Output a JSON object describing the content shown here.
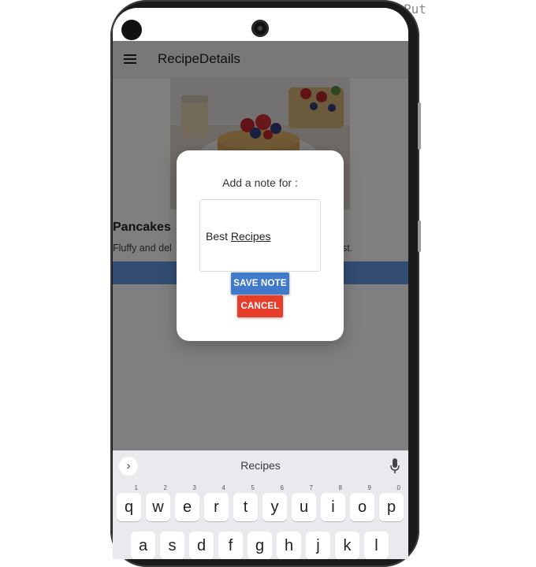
{
  "corner_text": "Put",
  "app_bar": {
    "title": "RecipeDetails",
    "menu_icon": "menu-icon"
  },
  "recipe": {
    "title": "Pancakes",
    "description_left": "Fluffy and del",
    "description_right": "st."
  },
  "dialog": {
    "title": "Add a note for :",
    "note_value_word1": "Best ",
    "note_value_word2": "Recipes",
    "save_label": "SAVE NOTE",
    "cancel_label": "CANCEL"
  },
  "keyboard": {
    "suggestion": "Recipes",
    "row1": [
      {
        "key": "q",
        "hint": "1"
      },
      {
        "key": "w",
        "hint": "2"
      },
      {
        "key": "e",
        "hint": "3"
      },
      {
        "key": "r",
        "hint": "4"
      },
      {
        "key": "t",
        "hint": "5"
      },
      {
        "key": "y",
        "hint": "6"
      },
      {
        "key": "u",
        "hint": "7"
      },
      {
        "key": "i",
        "hint": "8"
      },
      {
        "key": "o",
        "hint": "9"
      },
      {
        "key": "p",
        "hint": "0"
      }
    ],
    "row2": [
      "a",
      "s",
      "d",
      "f",
      "g",
      "h",
      "j",
      "k",
      "l"
    ]
  },
  "colors": {
    "save_button": "#4179cb",
    "cancel_button": "#e83d2b",
    "accent_bar": "#6598e4"
  }
}
